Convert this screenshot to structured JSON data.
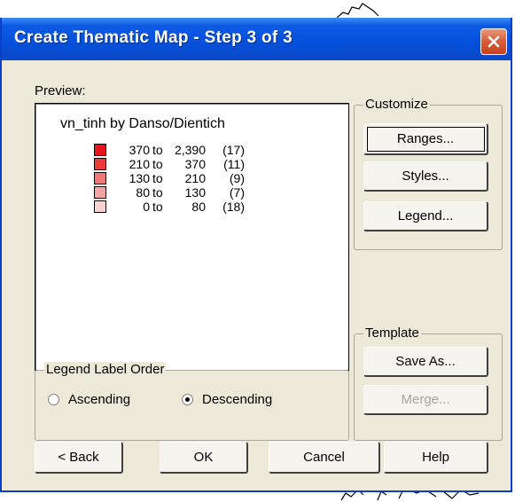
{
  "dialog": {
    "title": "Create Thematic Map - Step 3 of 3",
    "preview_label": "Preview:",
    "preview": {
      "map_title": "vn_tinh by Danso/Dientich",
      "legend": [
        {
          "low": "370",
          "to": "to",
          "high": "2,390",
          "count": "(17)",
          "color": "#e8141c"
        },
        {
          "low": "210",
          "to": "to",
          "high": "370",
          "count": "(11)",
          "color": "#ec3d3d"
        },
        {
          "low": "130",
          "to": "to",
          "high": "210",
          "count": "(9)",
          "color": "#f07878"
        },
        {
          "low": "80",
          "to": "to",
          "high": "130",
          "count": "(7)",
          "color": "#f4a4a4"
        },
        {
          "low": "0",
          "to": "to",
          "high": "80",
          "count": "(18)",
          "color": "#fad2d2"
        }
      ]
    },
    "customize": {
      "label": "Customize",
      "ranges": "Ranges...",
      "styles": "Styles...",
      "legend": "Legend..."
    },
    "template": {
      "label": "Template",
      "save_as": "Save As...",
      "merge": "Merge..."
    },
    "legend_order": {
      "label": "Legend Label Order",
      "ascending": "Ascending",
      "descending": "Descending",
      "selected": "Descending"
    },
    "footer": {
      "back": "< Back",
      "ok": "OK",
      "cancel": "Cancel",
      "help": "Help"
    }
  }
}
